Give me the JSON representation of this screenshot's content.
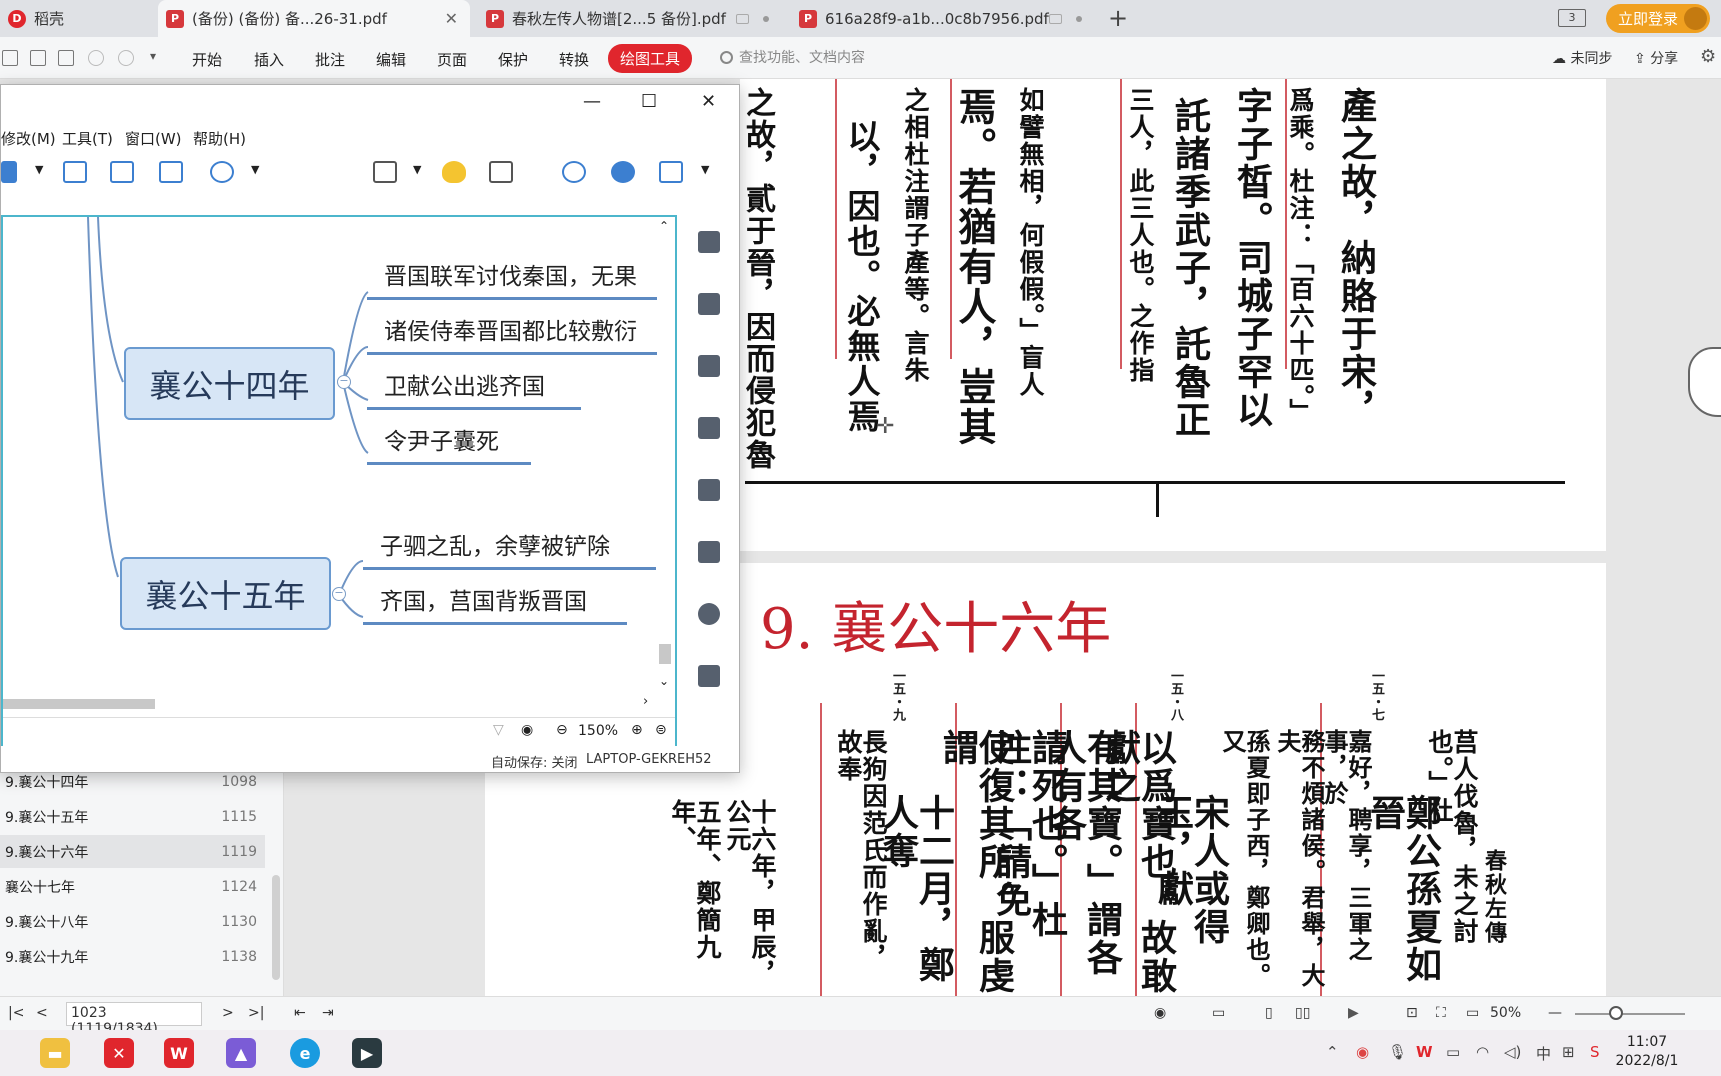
{
  "tabs": [
    {
      "label": "稻壳"
    },
    {
      "label": "(备份) (备份) 备...26-31.pdf"
    },
    {
      "label": "春秋左传人物谱[2...5 备份].pdf"
    },
    {
      "label": "616a28f9-a1b...0c8b7956.pdf"
    }
  ],
  "tabbar": {
    "plus": "+",
    "layout_badge": "3",
    "login": "立即登录"
  },
  "ribbon": {
    "menus": [
      "开始",
      "插入",
      "批注",
      "编辑",
      "页面",
      "保护",
      "转换"
    ],
    "draw_tool": "绘图工具",
    "search_placeholder": "查找功能、文档内容",
    "sync": "未同步",
    "share": "分享"
  },
  "mindmap": {
    "window_controls": {
      "minimize": "—",
      "maximize": "☐",
      "close": "✕"
    },
    "menus": [
      "修改(M)",
      "工具(T)",
      "窗口(W)",
      "帮助(H)"
    ],
    "topics": [
      {
        "title": "襄公十四年",
        "children": [
          "晋国联军讨伐秦国，无果",
          "诸侯侍奉晋国都比较敷衍",
          "卫献公出逃齐国",
          "令尹子囊死"
        ]
      },
      {
        "title": "襄公十五年",
        "children": [
          "子驷之乱，余孽被铲除",
          "齐国，莒国背叛晋国"
        ]
      }
    ],
    "zoom": "150%",
    "autosave": "自动保存: 关闭",
    "computer": "LAPTOP-GEKREH52"
  },
  "outline": {
    "items": [
      {
        "label": "9.襄公十四年",
        "page": "1098"
      },
      {
        "label": "9.襄公十五年",
        "page": "1115"
      },
      {
        "label": "9.襄公十六年",
        "page": "1119",
        "selected": true
      },
      {
        "label": "襄公十七年",
        "page": "1124"
      },
      {
        "label": "9.襄公十八年",
        "page": "1130"
      },
      {
        "label": "9.襄公十九年",
        "page": "1138"
      }
    ]
  },
  "document": {
    "upper_columns": [
      "之故，貳于晉，因而侵犯魯",
      "以，因也。必無人焉",
      "之相杜注謂子產等。言朱",
      "焉。若猶有人，豈其",
      "如譬無相，何假假。」盲人",
      "三人，此三人也。之作指",
      "託諸季武子，託魯正",
      "字子皙。司城子罕以",
      "爲乘。杜注：「百六十匹。」",
      "產之故，納賂于宋，"
    ],
    "chapter_title": "9. 襄公十六年",
    "page_numbers": [
      "一五・九",
      "一五・八",
      "一五・七"
    ],
    "lower_columns": [
      "五年、鄭簡九年、",
      "十六年，甲辰，公元",
      "長狗因范氏而作亂，故奉",
      "十二月，鄭人奪",
      "使復其所。服虔謂",
      "請死也。」杜注：「請免",
      "有其寶。」謂各人有各",
      "以爲寶也，故敢獻之",
      "宋人或得玉，獻",
      "孫夏即子西，鄭卿也。又",
      "務不煩諸侯。君舉，大夫",
      "嘉好，聘享，三軍之事，於",
      "鄭公孫夏如晉",
      "莒人伐魯，未之討也。」杜",
      "春秋左傳"
    ]
  },
  "statusbar": {
    "page_field": "1023 (1119/1834)",
    "zoom": "50%"
  },
  "taskbar": {
    "time": "11:07",
    "date": "2022/8/1",
    "ime": "中"
  },
  "colors": {
    "accent_red": "#e0262d",
    "topic_border": "#6a9ad0",
    "canvas_border": "#4cb6cc",
    "login_orange": "#f0a020"
  }
}
